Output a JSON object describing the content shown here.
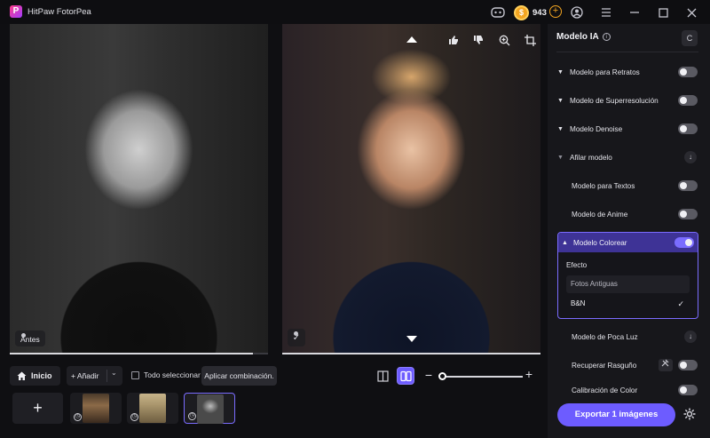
{
  "app": {
    "title": "HitPaw FotorPea",
    "logo_letter": "P"
  },
  "titlebar": {
    "credits": "943",
    "coin_symbol": "$",
    "add_symbol": "+"
  },
  "preview": {
    "before_label": "Antes",
    "after_check": "✓",
    "before_progress_percent": 94,
    "after_progress_percent": 100
  },
  "toolbar": {
    "home_label": "Inicio",
    "add_label": "+ Añadir",
    "add_chevron": "⌄",
    "select_all_label": "Todo seleccionar",
    "apply_label": "Aplicar combinación.",
    "zoom_minus": "−",
    "zoom_plus": "+",
    "zoom_percent": 0
  },
  "thumbnails": {
    "add_symbol": "+",
    "clock_symbol": "◷"
  },
  "side": {
    "title": "Modelo IA",
    "info_symbol": "i",
    "reset_symbol": "C",
    "models": [
      {
        "label": "Modelo para Retratos",
        "on": false
      },
      {
        "label": "Modelo de Superresolución",
        "on": false
      },
      {
        "label": "Modelo Denoise",
        "on": false
      },
      {
        "label": "Afilar modelo"
      },
      {
        "label": "Modelo para Textos",
        "on": false
      },
      {
        "label": "Modelo de Anime",
        "on": false
      },
      {
        "label": "Modelo Colorear",
        "on": true
      },
      {
        "label": "Modelo de Poca Luz"
      },
      {
        "label": "Recuperar Rasguño",
        "on": false
      },
      {
        "label": "Calibración de Color",
        "on": false
      }
    ],
    "colorear": {
      "effect_label": "Efecto",
      "options": [
        "Fotos Antiguas",
        "B&N"
      ],
      "selected": "B&N",
      "check": "✓"
    },
    "download_symbol": "↓",
    "export_label": "Exportar 1 imágenes"
  },
  "colors": {
    "accent": "#6d5cff",
    "accent_dark": "#3e3396",
    "coin": "#f3a521"
  }
}
